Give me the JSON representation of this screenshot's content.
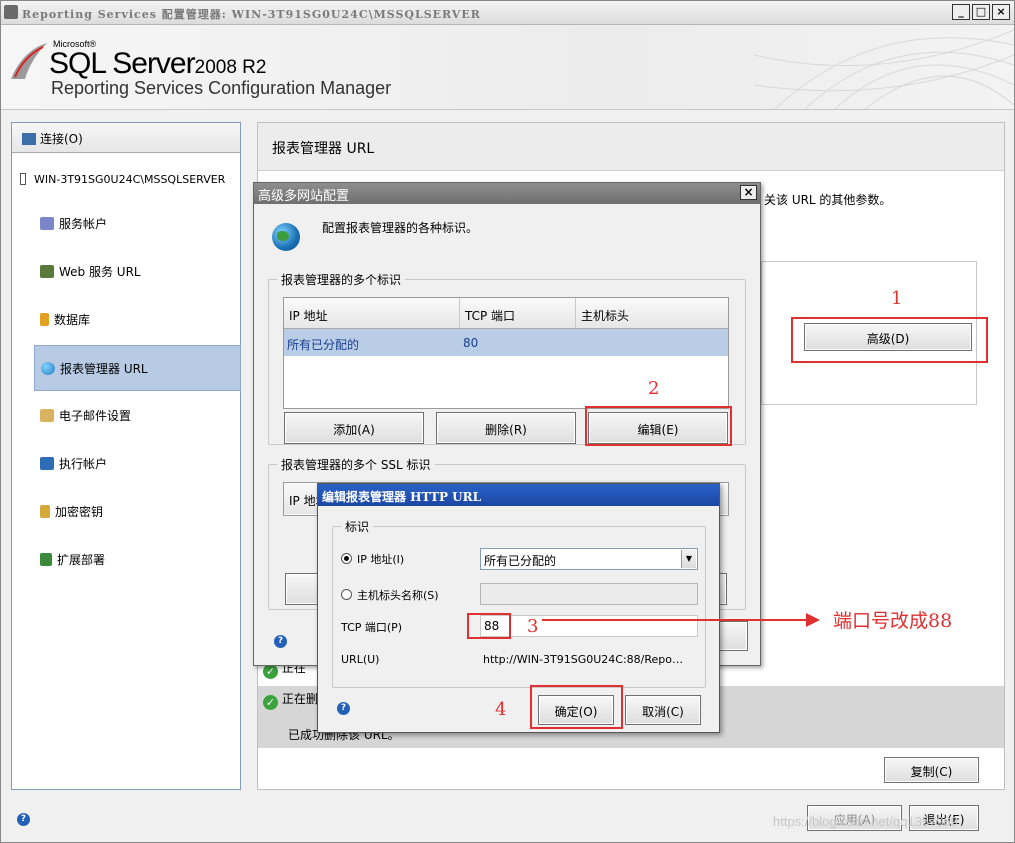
{
  "window": {
    "title": "Reporting Services 配置管理器: WIN-3T91SG0U24C\\MSSQLSERVER",
    "min": "_",
    "max": "□",
    "close": "×"
  },
  "banner": {
    "microsoft": "Microsoft®",
    "product": "SQL Server",
    "version": "2008 R2",
    "subtitle": "Reporting Services Configuration Manager"
  },
  "sidebar": {
    "connect": "连接(O)",
    "server": "WIN-3T91SG0U24C\\MSSQLSERVER",
    "items": [
      {
        "label": "服务帐户",
        "icon": "service-account-icon",
        "color": "#7a86c9"
      },
      {
        "label": "Web 服务 URL",
        "icon": "web-service-icon",
        "color": "#5a7a3a"
      },
      {
        "label": "数据库",
        "icon": "database-icon",
        "color": "#e0a020"
      },
      {
        "label": "报表管理器 URL",
        "icon": "globe-icon",
        "color": "#2a7ac0"
      },
      {
        "label": "电子邮件设置",
        "icon": "email-icon",
        "color": "#d9b360"
      },
      {
        "label": "执行帐户",
        "icon": "execution-account-icon",
        "color": "#2d6db8"
      },
      {
        "label": "加密密钥",
        "icon": "key-icon",
        "color": "#d4a83a"
      },
      {
        "label": "扩展部署",
        "icon": "scale-out-icon",
        "color": "#3a8a3a"
      }
    ]
  },
  "main": {
    "title": "报表管理器 URL",
    "desc": "关该 URL 的其他参数。",
    "advanced": "高级(D)",
    "status1": "正在",
    "status2": "正在删",
    "status_line": "已成功删除该 URL。",
    "copy": "复制(C)"
  },
  "footer": {
    "apply": "应用(A)",
    "exit": "退出(E)"
  },
  "dialog_multi": {
    "title": "高级多网站配置",
    "desc": "配置报表管理器的各种标识。",
    "group1": "报表管理器的多个标识",
    "columns": [
      "IP 地址",
      "TCP 端口",
      "主机标头"
    ],
    "rows": [
      [
        "所有已分配的",
        "80",
        ""
      ]
    ],
    "add": "添加(A)",
    "delete": "删除(R)",
    "edit": "编辑(E)",
    "group2": "报表管理器的多个 SSL 标识",
    "ssl_col": "IP 地址"
  },
  "dialog_edit": {
    "title": "编辑报表管理器 HTTP URL",
    "group": "标识",
    "ip_label": "IP 地址(I)",
    "ip_value": "所有已分配的",
    "host_label": "主机标头名称(S)",
    "port_label": "TCP 端口(P)",
    "port_value": "88",
    "url_label": "URL(U)",
    "url_value": "http://WIN-3T91SG0U24C:88/Repo…",
    "ok": "确定(O)",
    "cancel": "取消(C)"
  },
  "annotations": {
    "n1": "1",
    "n2": "2",
    "n3": "3",
    "n4": "4",
    "note": "端口号改成88",
    "color": "#e03030"
  },
  "watermark": "https://blog.csdn.net/qq1357969"
}
